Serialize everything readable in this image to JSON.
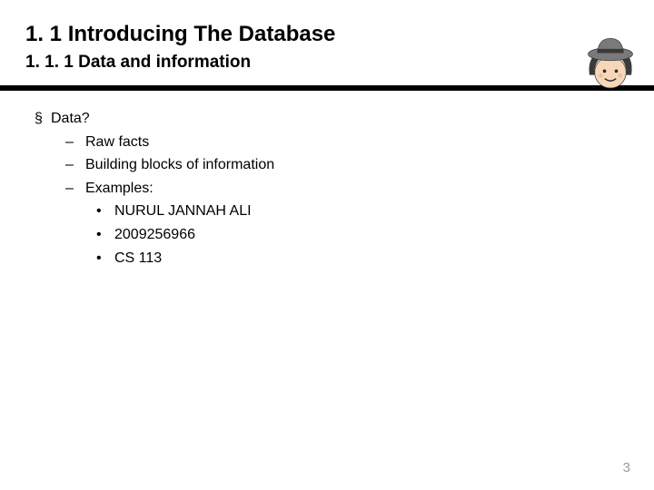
{
  "header": {
    "title": "1. 1 Introducing The Database",
    "subtitle": "1. 1. 1 Data and information"
  },
  "bullets": {
    "square": "§",
    "dash": "–",
    "dot": "•"
  },
  "content": {
    "l1_0": "Data?",
    "l2_0": "Raw facts",
    "l2_1": "Building blocks of information",
    "l2_2": "Examples:",
    "l3_0": "NURUL JANNAH ALI",
    "l3_1": "2009256966",
    "l3_2": "CS 113"
  },
  "page_number": "3",
  "avatar_alt": "cartoon-person-with-hat"
}
